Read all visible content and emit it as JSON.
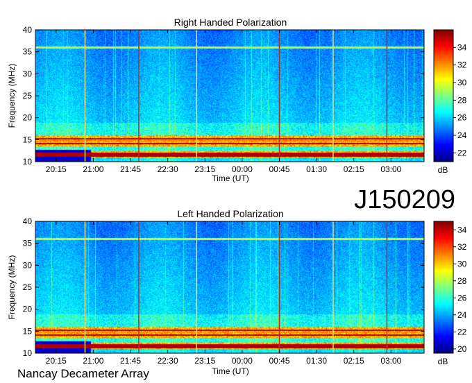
{
  "identifier": "J150209",
  "credit": "Nancay Decameter Array",
  "chart_data": [
    {
      "type": "heatmap",
      "title": "Right Handed Polarization",
      "xlabel": "Time (UT)",
      "ylabel": "Frequency (MHz)",
      "x_tick_labels": [
        "20:15",
        "21:00",
        "21:45",
        "22:30",
        "23:15",
        "00:00",
        "00:45",
        "01:30",
        "02:15",
        "03:00"
      ],
      "y_ticks": [
        10,
        15,
        20,
        25,
        30,
        35,
        40
      ],
      "ylim": [
        10,
        40
      ],
      "colorbar": {
        "label": "dB",
        "ticks": [
          22,
          24,
          26,
          28,
          30,
          32,
          34
        ],
        "range": [
          21,
          36
        ]
      },
      "colormap": "jet",
      "features": {
        "vertical_markers_utc": [
          "20:50",
          "21:55",
          "23:05",
          "00:45",
          "01:50",
          "02:55"
        ],
        "strong_bands_mhz": [
          11.7,
          14.2,
          15.3
        ],
        "interference_band_mhz": 36
      }
    },
    {
      "type": "heatmap",
      "title": "Left Handed Polarization",
      "xlabel": "Time (UT)",
      "ylabel": "Frequency (MHz)",
      "x_tick_labels": [
        "20:15",
        "21:00",
        "21:45",
        "22:30",
        "23:15",
        "00:00",
        "00:45",
        "01:30",
        "02:15",
        "03:00"
      ],
      "y_ticks": [
        10,
        15,
        20,
        25,
        30,
        35,
        40
      ],
      "ylim": [
        10,
        40
      ],
      "colorbar": {
        "label": "dB",
        "ticks": [
          20,
          22,
          24,
          26,
          28,
          30,
          32,
          34
        ],
        "range": [
          19.5,
          35
        ]
      },
      "colormap": "jet",
      "features": {
        "vertical_markers_utc": [
          "20:50",
          "21:55",
          "23:05",
          "00:45",
          "01:50",
          "02:55"
        ],
        "strong_bands_mhz": [
          11.7,
          14.2,
          15.3
        ],
        "interference_band_mhz": 36
      }
    }
  ]
}
